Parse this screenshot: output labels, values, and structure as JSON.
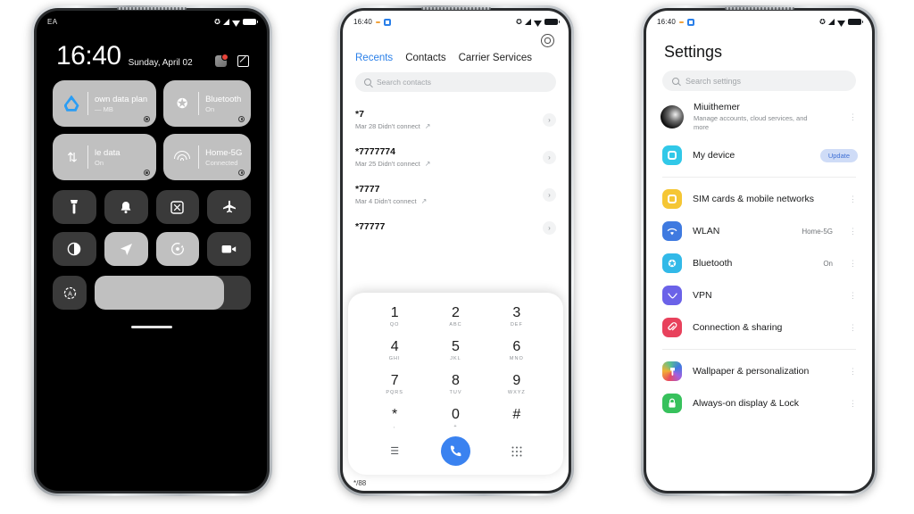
{
  "phone1": {
    "name": "lockscreen-control-center",
    "statusbar": {
      "carrier": "EA",
      "icons": [
        "bluetooth-icon",
        "signal-icon",
        "wifi-icon",
        "battery-icon"
      ]
    },
    "clock": {
      "time": "16:40",
      "date": "Sunday, April 02"
    },
    "clock_icons": [
      "app-badge-icon",
      "edit-icon"
    ],
    "big_tiles": [
      {
        "icon": "data-drop-icon",
        "title": "own data plan",
        "sub": "— MB"
      },
      {
        "icon": "bluetooth-icon",
        "title": "Bluetooth",
        "sub": "On"
      },
      {
        "icon": "mobile-data-icon",
        "title": "le data",
        "sub": "On"
      },
      {
        "icon": "wifi-icon",
        "title": "Home-5G",
        "sub": "Connected"
      }
    ],
    "small_tiles": [
      {
        "icon": "flashlight-icon",
        "active": false
      },
      {
        "icon": "bell-icon",
        "active": false
      },
      {
        "icon": "screenshot-icon",
        "active": false
      },
      {
        "icon": "airplane-icon",
        "active": false
      },
      {
        "icon": "dark-mode-icon",
        "active": false
      },
      {
        "icon": "location-icon",
        "active": true
      },
      {
        "icon": "auto-rotate-icon",
        "active": true
      },
      {
        "icon": "screen-record-icon",
        "active": false
      }
    ],
    "brightness": {
      "icon": "auto-brightness-icon",
      "value": 83
    }
  },
  "phone2": {
    "name": "dialer",
    "statusbar": {
      "time": "16:40",
      "icons": [
        "dash-icon",
        "app-icon",
        "bluetooth-icon",
        "signal-icon",
        "wifi-icon",
        "battery-icon"
      ]
    },
    "gear": "settings-gear-icon",
    "tabs": [
      {
        "label": "Recents",
        "active": true
      },
      {
        "label": "Contacts",
        "active": false
      },
      {
        "label": "Carrier Services",
        "active": false
      }
    ],
    "search": {
      "placeholder": "Search contacts",
      "icon": "search-icon"
    },
    "calls": [
      {
        "number": "*7",
        "meta": "Mar 28 Didn't connect"
      },
      {
        "number": "*7777774",
        "meta": "Mar 25 Didn't connect"
      },
      {
        "number": "*7777",
        "meta": "Mar 4 Didn't connect"
      },
      {
        "number": "*77777",
        "meta": ""
      }
    ],
    "keypad": [
      {
        "digit": "1",
        "letters": "QO"
      },
      {
        "digit": "2",
        "letters": "ABC"
      },
      {
        "digit": "3",
        "letters": "DEF"
      },
      {
        "digit": "4",
        "letters": "GHI"
      },
      {
        "digit": "5",
        "letters": "JKL"
      },
      {
        "digit": "6",
        "letters": "MNO"
      },
      {
        "digit": "7",
        "letters": "PQRS"
      },
      {
        "digit": "8",
        "letters": "TUV"
      },
      {
        "digit": "9",
        "letters": "WXYZ"
      },
      {
        "digit": "*",
        "letters": ","
      },
      {
        "digit": "0",
        "letters": "+"
      },
      {
        "digit": "#",
        "letters": ""
      }
    ],
    "keypad_footer": {
      "menu": "menu-icon",
      "call": "call-icon",
      "dialpad": "dialpad-icon"
    },
    "behind_text": "*/88"
  },
  "phone3": {
    "name": "settings",
    "statusbar": {
      "time": "16:40",
      "icons": [
        "dash-icon",
        "app-icon",
        "bluetooth-icon",
        "signal-icon",
        "wifi-icon",
        "battery-icon"
      ]
    },
    "title": "Settings",
    "search": {
      "placeholder": "Search settings",
      "icon": "search-icon"
    },
    "account": {
      "name": "Miuithemer",
      "sub": "Manage accounts, cloud services, and more",
      "avatar": "avatar-icon"
    },
    "my_device": {
      "label": "My device",
      "badge": "Update",
      "icon": "device-icon"
    },
    "groups": [
      {
        "items": [
          {
            "label": "SIM cards & mobile networks",
            "value": "",
            "icon": "sim-icon",
            "color": "#f5c634"
          },
          {
            "label": "WLAN",
            "value": "Home-5G",
            "icon": "wifi-icon",
            "color": "#3f7ae0"
          },
          {
            "label": "Bluetooth",
            "value": "On",
            "icon": "bluetooth-icon",
            "color": "#32b9e8"
          },
          {
            "label": "VPN",
            "value": "",
            "icon": "vpn-icon",
            "color": "#6b62e8"
          },
          {
            "label": "Connection & sharing",
            "value": "",
            "icon": "connection-icon",
            "color": "#e8415c"
          }
        ]
      },
      {
        "items": [
          {
            "label": "Wallpaper & personalization",
            "value": "",
            "icon": "wallpaper-icon",
            "color": "rainbow"
          },
          {
            "label": "Always-on display & Lock",
            "value": "",
            "icon": "lock-icon",
            "color": "#37c15c"
          }
        ]
      }
    ]
  }
}
